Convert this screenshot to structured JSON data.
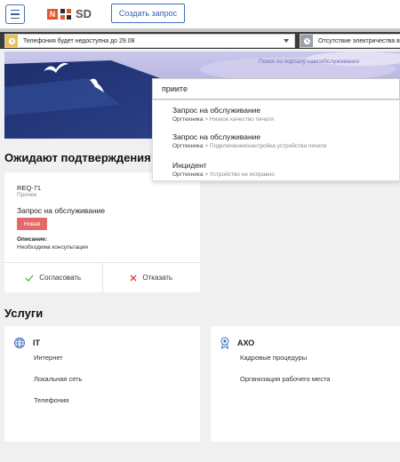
{
  "header": {
    "logo_text": "SD",
    "logo_letter": "N",
    "create_button": "Создать запрос"
  },
  "notices": [
    {
      "text": "Телефония будет недоступна до 29.08"
    },
    {
      "text": "Отсутствие электричества в"
    }
  ],
  "banner": {
    "portal_link": "Поиск по порталу самообслуживания"
  },
  "search": {
    "value": "приите"
  },
  "suggestions": [
    {
      "title": "Запрос на обслуживание",
      "category": "Оргтехника",
      "separator": ">",
      "sub": "Низкое качество печати"
    },
    {
      "title": "Запрос на обслуживание",
      "category": "Оргтехника",
      "separator": ">",
      "sub": "Подключение\\настройка устройства печати"
    },
    {
      "title": "Инцидент",
      "category": "Оргтехника",
      "separator": ">",
      "sub": "Устройство не исправно"
    }
  ],
  "pending": {
    "title": "Ожидают подтверждения",
    "card": {
      "id": "REQ-71",
      "subtitle": "Прочее",
      "title": "Запрос на обслуживание",
      "status": "Новая",
      "desc_label": "Описание:",
      "desc_value": "Необходима консультация",
      "approve": "Согласовать",
      "reject": "Отказать"
    }
  },
  "services": {
    "title": "Услуги",
    "groups": [
      {
        "name": "IT",
        "items": [
          "Интернет",
          "Локальная сеть",
          "Телефония"
        ]
      },
      {
        "name": "АХО",
        "items": [
          "Кадровые процедуры",
          "Организация рабочего места"
        ]
      }
    ]
  },
  "colors": {
    "accent": "#3d6fc4",
    "status_new": "#e46a6a",
    "approve": "#4caf50",
    "reject": "#e53935",
    "warning": "#e8c15a"
  }
}
